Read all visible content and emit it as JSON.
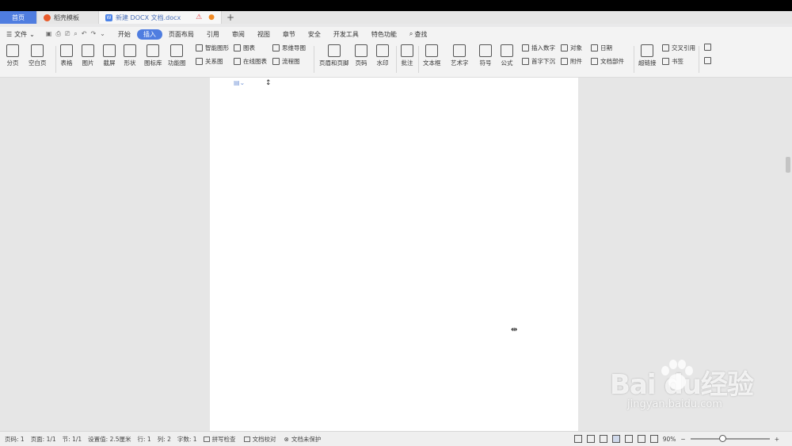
{
  "tabs": [
    {
      "label": "首页"
    },
    {
      "label": "稻壳模板"
    },
    {
      "label": "新建 DOCX 文档.docx"
    }
  ],
  "tab_add": "+",
  "menu": {
    "file": "文件",
    "items": [
      "开始",
      "插入",
      "页面布局",
      "引用",
      "审阅",
      "视图",
      "章节",
      "安全",
      "开发工具",
      "特色功能"
    ],
    "active": "插入",
    "search": "查找"
  },
  "ribbon": {
    "page_break": "分页",
    "blank_page": "空白页",
    "table": "表格",
    "picture": "图片",
    "screenshot": "截屏",
    "shape": "形状",
    "icon_lib": "图标库",
    "func_chart": "功能图",
    "smart_shape": "智能图形",
    "chart": "图表",
    "mindmap": "思维导图",
    "relation": "关系图",
    "online_chart": "在线图表",
    "flowchart": "流程图",
    "header_footer": "页眉和页脚",
    "page_num": "页码",
    "watermark": "水印",
    "comment": "批注",
    "textbox": "文本框",
    "wordart": "艺术字",
    "symbol": "符号",
    "formula": "公式",
    "insert_num": "插入数字",
    "object": "对象",
    "date": "日期",
    "dropcap": "首字下沉",
    "attachment": "附件",
    "doc_parts": "文档部件",
    "hyperlink": "超链接",
    "cross_ref": "交叉引用",
    "bookmark": "书签"
  },
  "status": {
    "page_no": "页码: 1",
    "pages": "页面: 1/1",
    "section": "节: 1/1",
    "setting": "设置值: 2.5厘米",
    "row": "行: 1",
    "col": "列: 2",
    "words": "字数: 1",
    "spell": "拼写检查",
    "proof": "文档校对",
    "protect": "文档未保护",
    "zoom": "90%"
  },
  "watermark": {
    "main": "Bai du经验",
    "sub": "jingyan.baidu.com"
  }
}
